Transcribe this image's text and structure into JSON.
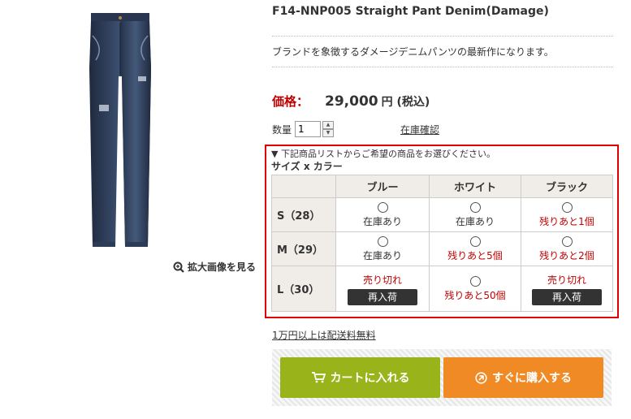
{
  "product": {
    "title": "F14-NNP005 Straight Pant Denim(Damage)",
    "description": "ブランドを象徴するダメージデニムパンツの最新作になります。",
    "zoom_label": "拡大画像を見る"
  },
  "price": {
    "label": "価格：",
    "value": "29,000",
    "unit": "円 (税込)"
  },
  "quantity": {
    "label": "数量",
    "value": "1",
    "stock_check_label": "在庫確認"
  },
  "variants": {
    "instruction": "▼ 下記商品リストからご希望の商品をお選びください。",
    "heading": "サイズ x カラー",
    "colors": [
      "ブルー",
      "ホワイト",
      "ブラック"
    ],
    "rows": [
      {
        "size": "S（28）",
        "cells": [
          {
            "status": "在庫あり",
            "type": "ok"
          },
          {
            "status": "在庫あり",
            "type": "ok"
          },
          {
            "status": "残りあと1個",
            "type": "low"
          }
        ]
      },
      {
        "size": "M（29）",
        "cells": [
          {
            "status": "在庫あり",
            "type": "ok"
          },
          {
            "status": "残りあと5個",
            "type": "low"
          },
          {
            "status": "残りあと2個",
            "type": "low"
          }
        ]
      },
      {
        "size": "L（30）",
        "cells": [
          {
            "status": "売り切れ",
            "type": "soldout",
            "button": "再入荷"
          },
          {
            "status": "残りあと50個",
            "type": "low"
          },
          {
            "status": "売り切れ",
            "type": "soldout",
            "button": "再入荷"
          }
        ]
      }
    ]
  },
  "shipping_note": "1万円以上は配送料無料",
  "buttons": {
    "cart": "カートに入れる",
    "buy_now": "すぐに購入する"
  },
  "colors": {
    "price_red": "#c00000",
    "highlight_border": "#e00000",
    "cart_green": "#99b41a",
    "buy_orange": "#f08a24"
  }
}
